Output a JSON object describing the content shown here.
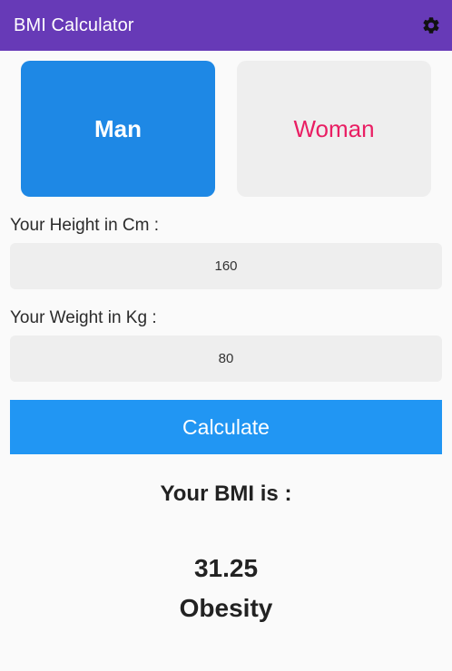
{
  "appbar": {
    "title": "BMI Calculator",
    "settings_icon": "gear-icon",
    "color": "#673ab7"
  },
  "gender": {
    "man_label": "Man",
    "woman_label": "Woman",
    "selected": "man",
    "selected_color": "#1e88e5",
    "woman_text_color": "#e91e63"
  },
  "height": {
    "label": "Your Height in Cm :",
    "value": "160"
  },
  "weight": {
    "label": "Your Weight in Kg :",
    "value": "80"
  },
  "calculate": {
    "label": "Calculate",
    "color": "#2196f3"
  },
  "result": {
    "heading": "Your BMI is :",
    "value": "31.25",
    "category": "Obesity"
  }
}
